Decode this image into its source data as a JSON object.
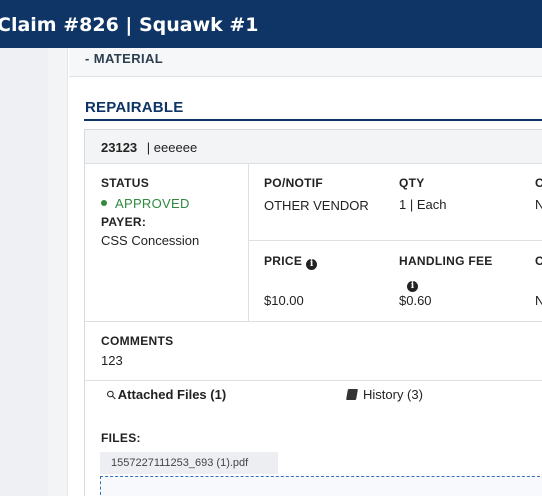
{
  "header": {
    "title": "Claim #826 | Squawk #1"
  },
  "section": {
    "material_label": "- MATERIAL",
    "title": "REPAIRABLE"
  },
  "card": {
    "part_number": "23123",
    "separator": "|",
    "description": "eeeeee",
    "status_label": "STATUS",
    "status_value": "APPROVED",
    "payer_label": "PAYER:",
    "payer_value": "CSS Concession",
    "po_label": "PO/NOTIF",
    "po_value": "OTHER VENDOR",
    "qty_label": "QTY",
    "qty_value": "1 | Each",
    "c_label": "C",
    "c_value": "N",
    "price_label": "PRICE",
    "price_value": "$10.00",
    "handling_label": "HANDLING FEE",
    "handling_value": "$0.60",
    "c2_label": "C",
    "c2_value": "N",
    "comments_label": "COMMENTS",
    "comments_value": "123"
  },
  "tabs": {
    "attached": "Attached Files (1)",
    "history": "History (3)"
  },
  "files": {
    "label": "FILES:",
    "items": [
      "1557227111253_693 (1).pdf"
    ]
  },
  "colors": {
    "header_bg": "#0e3566",
    "approved": "#2f8a3e"
  },
  "icons": [
    "info-icon",
    "paperclip-icon",
    "book-icon"
  ]
}
